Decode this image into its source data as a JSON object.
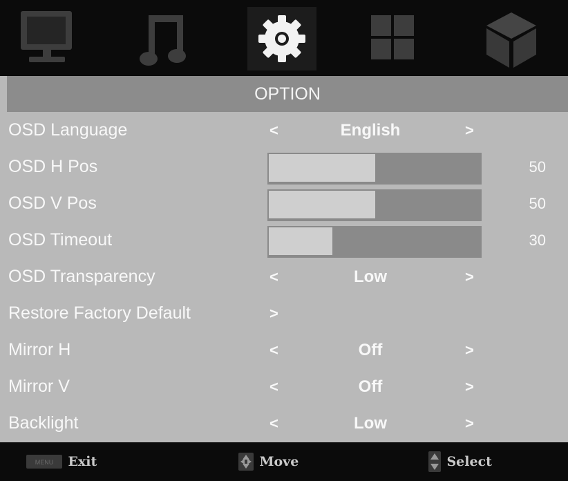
{
  "tabs": [
    {
      "icon": "monitor-icon"
    },
    {
      "icon": "music-note-icon"
    },
    {
      "icon": "gear-icon",
      "active": true
    },
    {
      "icon": "grid-icon"
    },
    {
      "icon": "cube-icon"
    }
  ],
  "title": "OPTION",
  "items": {
    "osd_language": {
      "label": "OSD Language",
      "value": "English"
    },
    "osd_h_pos": {
      "label": "OSD H Pos",
      "level": 50,
      "max": 100,
      "value": "50"
    },
    "osd_v_pos": {
      "label": "OSD V Pos",
      "level": 50,
      "max": 100,
      "value": "50"
    },
    "osd_timeout": {
      "label": "OSD Timeout",
      "level": 30,
      "max": 100,
      "value": "30"
    },
    "osd_transparency": {
      "label": "OSD Transparency",
      "value": "Low"
    },
    "restore_factory_default": {
      "label": "Restore Factory Default"
    },
    "mirror_h": {
      "label": "Mirror H",
      "value": "Off"
    },
    "mirror_v": {
      "label": "Mirror V",
      "value": "Off"
    },
    "backlight": {
      "label": "Backlight",
      "value": "Low"
    }
  },
  "arrows": {
    "left": "<",
    "right": ">"
  },
  "footer": {
    "exit": {
      "key_text": "MENU",
      "label": "Exit"
    },
    "move": {
      "label": "Move"
    },
    "select": {
      "label": "Select"
    }
  },
  "colors": {
    "background": "#b9b9b9",
    "title_bar": "#8c8c8c",
    "icon_bar": "#0b0b0b",
    "text": "#f8f8f8"
  }
}
